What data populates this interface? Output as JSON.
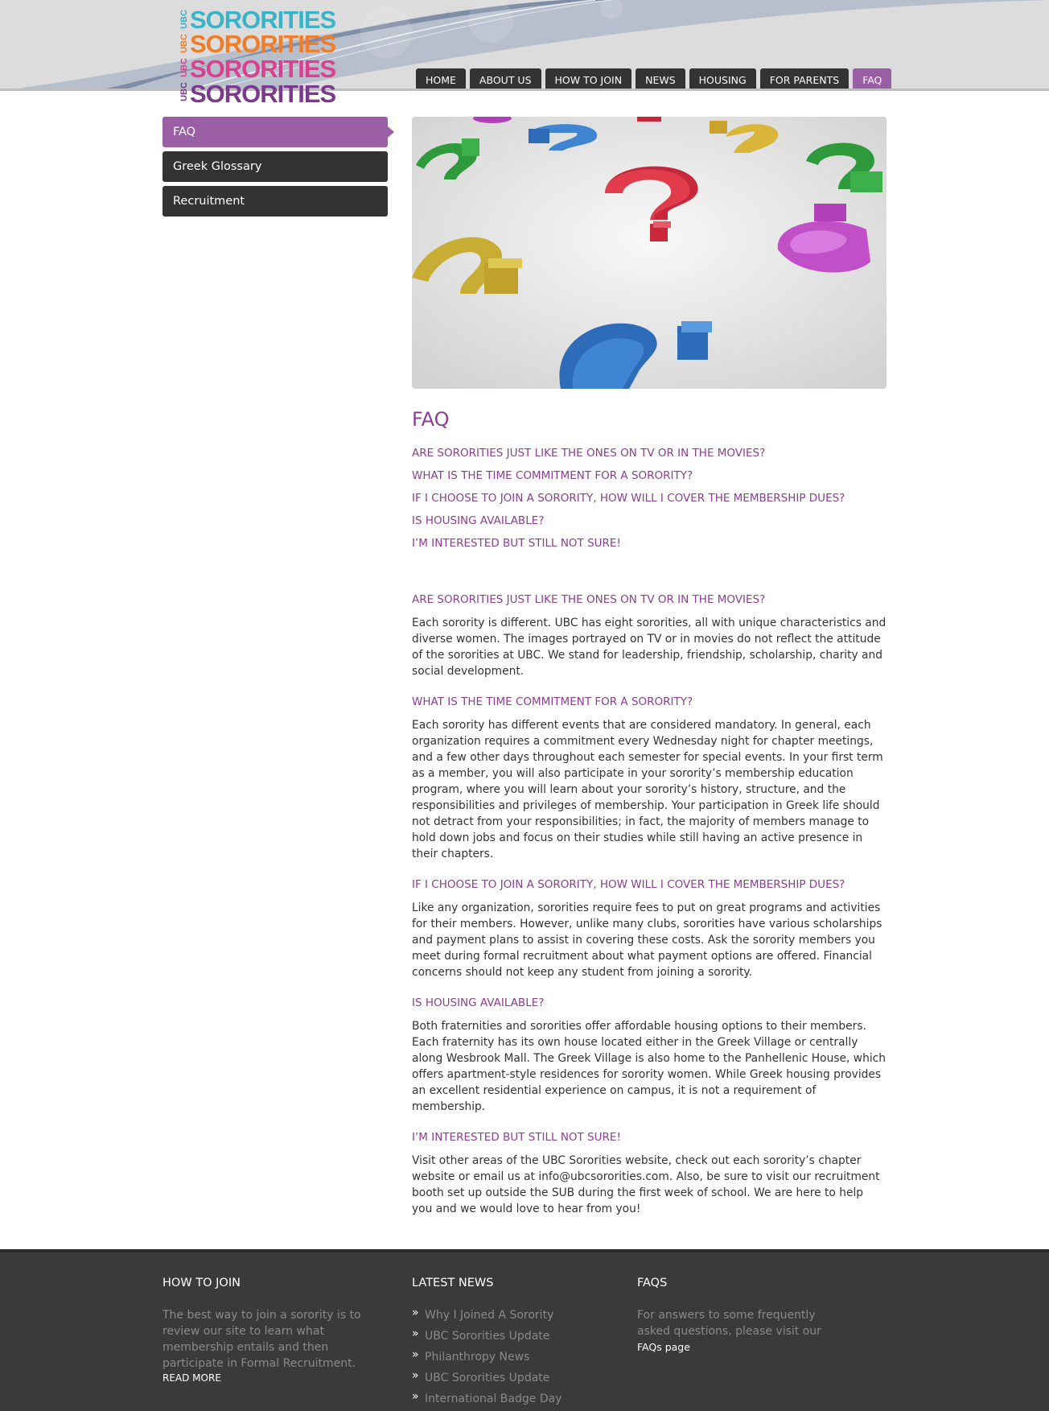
{
  "logo": {
    "side_text": [
      "UBC",
      "UBC",
      "UBC",
      "UBC"
    ],
    "rows": [
      "SORORITIES",
      "SORORITIES",
      "SORORITIES",
      "SORORITIES"
    ],
    "colors": [
      "#3ab3c8",
      "#f07d2a",
      "#d9408f",
      "#7b3a8c"
    ]
  },
  "nav": {
    "items": [
      {
        "label": "HOME"
      },
      {
        "label": "ABOUT US"
      },
      {
        "label": "HOW TO JOIN"
      },
      {
        "label": "NEWS"
      },
      {
        "label": "HOUSING"
      },
      {
        "label": "FOR PARENTS"
      },
      {
        "label": "FAQ",
        "active": true
      }
    ]
  },
  "sidebar": {
    "items": [
      {
        "label": "FAQ",
        "active": true
      },
      {
        "label": "Greek Glossary"
      },
      {
        "label": "Recruitment"
      }
    ]
  },
  "main": {
    "title": "FAQ",
    "toc": [
      "ARE SORORITIES JUST LIKE THE ONES ON TV OR IN THE MOVIES?",
      "WHAT IS THE TIME COMMITMENT FOR A SORORITY?",
      "IF I CHOOSE TO JOIN A SORORITY, HOW WILL I COVER THE MEMBERSHIP DUES?",
      "IS HOUSING AVAILABLE?",
      "I’M INTERESTED BUT STILL NOT SURE!"
    ],
    "qa": [
      {
        "q": "ARE SORORITIES JUST LIKE THE ONES ON TV OR IN THE MOVIES?",
        "a": "Each sorority is different. UBC has eight sororities, all with unique characteristics and diverse women. The images portrayed on TV or in movies do not reflect the attitude of the sororities at UBC. We stand for leadership, friendship, scholarship, charity and social development."
      },
      {
        "q": "WHAT IS THE TIME COMMITMENT FOR A SORORITY?",
        "a": "Each sorority has different events that are considered mandatory. In general, each organization requires a commitment every Wednesday night for chapter meetings, and a few other days throughout each semester for special events. In your first term as a member, you will also participate in your sorority’s membership education program, where you will learn about your sorority’s history, structure, and the responsibilities and privileges of membership. Your participation in Greek life should not detract from your responsibilities; in fact, the majority of members manage to hold down jobs and focus on their studies while still having an active presence in their chapters."
      },
      {
        "q": "IF I CHOOSE TO JOIN A SORORITY, HOW WILL I COVER THE MEMBERSHIP DUES?",
        "a": "Like any organization, sororities require fees to put on great programs and activities for their members. However, unlike many clubs, sororities have various scholarships and payment plans to assist in covering these costs. Ask the sorority members you meet during formal recruitment about what payment options are offered. Financial concerns should not keep any student from joining a sorority."
      },
      {
        "q": "IS HOUSING AVAILABLE?",
        "a": "Both fraternities and sororities offer affordable housing options to their members. Each fraternity has its own house located either in the Greek Village or centrally along Wesbrook Mall. The Greek Village is also home to the Panhellenic House, which offers apartment-style residences for sorority women. While Greek housing provides an excellent residential experience on campus, it is not a requirement of membership."
      },
      {
        "q": "I’M INTERESTED BUT STILL NOT SURE!",
        "a": "Visit other areas of the UBC Sororities website, check out each sorority’s chapter website or email us at info@ubcsororities.com. Also, be sure to visit our recruitment booth set up outside the SUB during the first week of school. We are here to help you and we would love to hear from you!"
      }
    ]
  },
  "footer": {
    "join": {
      "heading": "HOW TO JOIN",
      "text": "The best way to join a sorority is to review our site to learn what membership entails and then participate in Formal Recruitment.",
      "more": "READ MORE"
    },
    "news": {
      "heading": "LATEST NEWS",
      "items": [
        "Why I Joined A Sorority",
        "UBC Sororities Update",
        "Philanthropy News",
        "UBC Sororities Update",
        "International Badge Day"
      ]
    },
    "faqs": {
      "heading": "FAQS",
      "text": "For answers to some frequently asked questions, please visit our",
      "link": "FAQs page"
    }
  },
  "colors": {
    "purple": "#9a5ea4",
    "heading_purple": "#8a3f8f",
    "dark": "#333333",
    "footer_bg": "#3a3a3a"
  }
}
